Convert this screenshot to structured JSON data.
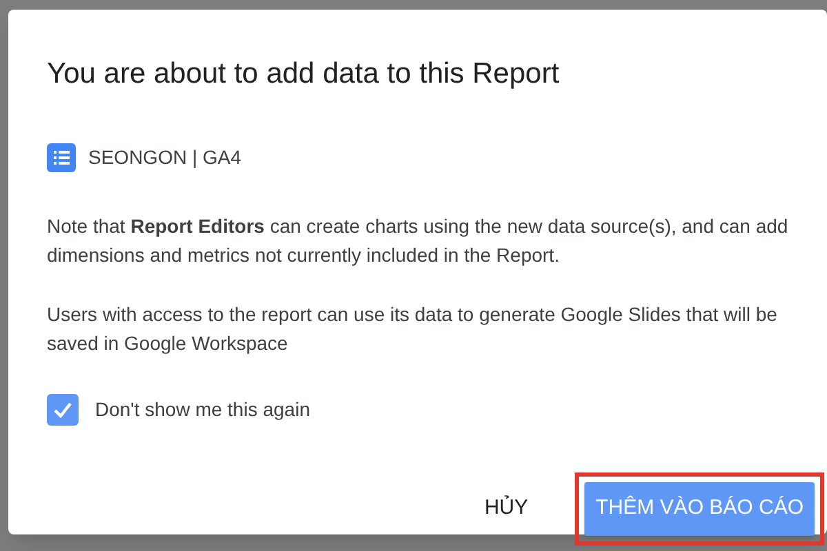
{
  "dialog": {
    "title": "You are about to add data to this Report",
    "source": {
      "name": "SEONGON | GA4"
    },
    "paragraphs": [
      "Note that **Report Editors** can create charts using the new data source(s), and can add dimensions and metrics not currently included in the Report.",
      "Users with access to the report can use its data to generate Google Slides that will be saved in Google Workspace"
    ],
    "checkbox": {
      "label": "Don't show me this again",
      "checked": true
    },
    "buttons": [
      {
        "label": "HỦY",
        "kind": "text",
        "highlighted": false
      },
      {
        "label": "THÊM VÀO BÁO CÁO",
        "kind": "primary",
        "highlighted": true
      }
    ]
  }
}
